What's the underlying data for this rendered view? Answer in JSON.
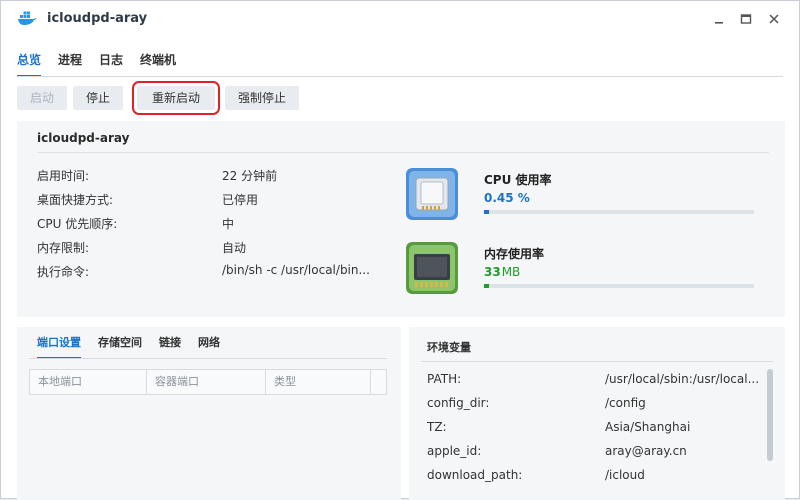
{
  "window": {
    "title": "icloudpd-aray",
    "icon": "docker-whale-icon",
    "controls": {
      "minimize": "minimize-icon",
      "maximize": "maximize-icon",
      "close": "close-icon"
    }
  },
  "tabs": [
    {
      "label": "总览",
      "active": true
    },
    {
      "label": "进程",
      "active": false
    },
    {
      "label": "日志",
      "active": false
    },
    {
      "label": "终端机",
      "active": false
    }
  ],
  "toolbar": {
    "start_label": "启动",
    "stop_label": "停止",
    "restart_label": "重新启动",
    "force_stop_label": "强制停止"
  },
  "overview": {
    "container_name": "icloudpd-aray",
    "rows": [
      {
        "key": "启用时间:",
        "value": "22 分钟前"
      },
      {
        "key": "桌面快捷方式:",
        "value": "已停用"
      },
      {
        "key": "CPU 优先顺序:",
        "value": "中"
      },
      {
        "key": "内存限制:",
        "value": "自动"
      },
      {
        "key": "执行命令:",
        "value": "/bin/sh -c /usr/local/bin..."
      }
    ],
    "cpu": {
      "title": "CPU 使用率",
      "value": "0.45 %",
      "fraction": 0.0045,
      "color": "#1a73c9"
    },
    "memory": {
      "title": "内存使用率",
      "value": "33",
      "unit": "MB",
      "fraction": 0.01,
      "color": "#1f9d2a"
    }
  },
  "ports": {
    "subtabs": [
      {
        "label": "端口设置",
        "active": true
      },
      {
        "label": "存储空间",
        "active": false
      },
      {
        "label": "链接",
        "active": false
      },
      {
        "label": "网络",
        "active": false
      }
    ],
    "columns": [
      "本地端口",
      "容器端口",
      "类型"
    ]
  },
  "environment": {
    "title": "环境变量",
    "rows": [
      {
        "key": "PATH:",
        "value": "/usr/local/sbin:/usr/local..."
      },
      {
        "key": "config_dir:",
        "value": "/config"
      },
      {
        "key": "TZ:",
        "value": "Asia/Shanghai"
      },
      {
        "key": "apple_id:",
        "value": "aray@aray.cn"
      },
      {
        "key": "download_path:",
        "value": "/icloud"
      }
    ]
  }
}
